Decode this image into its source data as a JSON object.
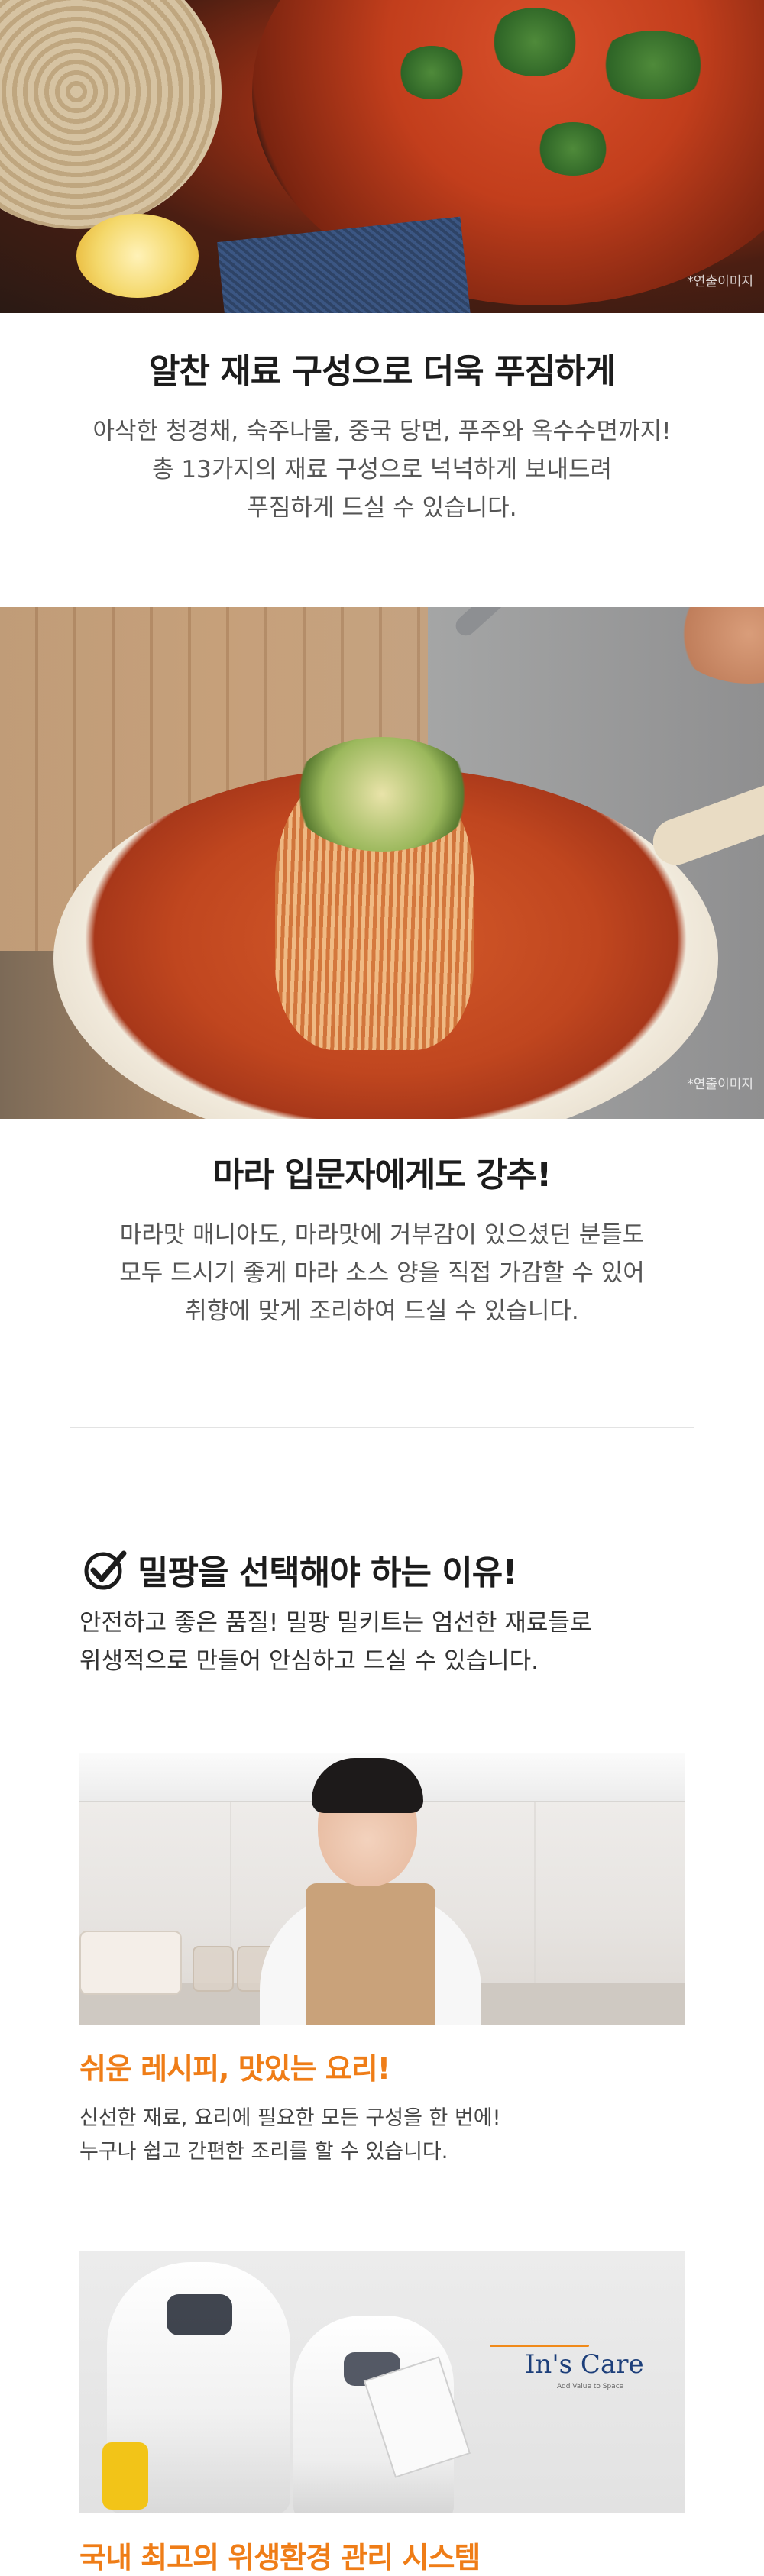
{
  "section1": {
    "photo_note": "*연출이미지",
    "title": "알찬 재료 구성으로 더욱 푸짐하게",
    "desc": [
      "아삭한 청경채, 숙주나물, 중국 당면, 푸주와 옥수수면까지!",
      "총 13가지의 재료 구성으로 넉넉하게 보내드려",
      "푸짐하게 드실 수 있습니다."
    ]
  },
  "section2": {
    "photo_note": "*연출이미지",
    "title": "마라 입문자에게도 강추!",
    "desc": [
      "마라맛 매니아도, 마라맛에 거부감이 있으셨던 분들도",
      "모두 드시기 좋게 마라 소스 양을 직접 가감할 수 있어",
      "취향에 맞게 조리하여 드실 수 있습니다."
    ]
  },
  "reason": {
    "icon": "check-icon",
    "title": "밀팡을 선택해야 하는 이유!",
    "desc": [
      "안전하고 좋은 품질! 밀팡 밀키트는 엄선한 재료들로",
      "위생적으로 만들어 안심하고 드실 수 있습니다."
    ]
  },
  "recipe": {
    "title": "쉬운 레시피, 맛있는 요리!",
    "desc": [
      "신선한 재료, 요리에 필요한 모든 구성을 한 번에!",
      "누구나 쉽고 간편한 조리를 할 수 있습니다."
    ]
  },
  "hygiene": {
    "logo_text": "In's Care",
    "logo_sub": "Add Value to Space",
    "title": "국내 최고의 위생환경 관리 시스템"
  },
  "colors": {
    "accent_orange": "#ef7d17",
    "logo_blue": "#1d3f7a"
  }
}
